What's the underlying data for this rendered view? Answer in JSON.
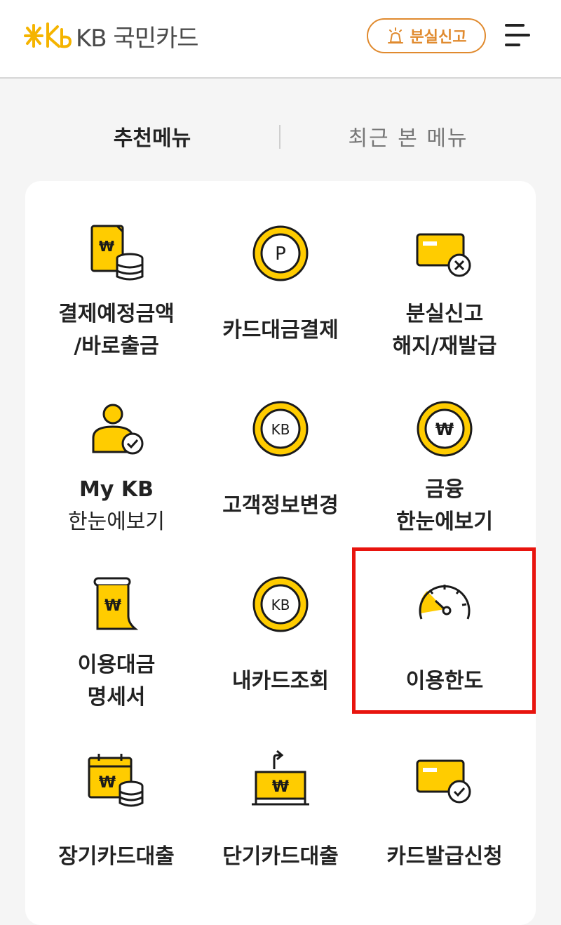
{
  "header": {
    "logo_text": "KB 국민카드",
    "lost_report_label": "분실신고"
  },
  "tabs": [
    {
      "label": "추천메뉴"
    },
    {
      "label": "최근 본 메뉴"
    }
  ],
  "menu": [
    {
      "icon": "bill-coins-icon",
      "lines": [
        "결제예정금액",
        "/바로출금"
      ]
    },
    {
      "icon": "point-coin-icon",
      "lines": [
        "카드대금결제"
      ]
    },
    {
      "icon": "card-cancel-icon",
      "lines": [
        "분실신고",
        "해지/재발급"
      ]
    },
    {
      "icon": "user-check-icon",
      "lines": [
        "My KB",
        "한눈에보기"
      ]
    },
    {
      "icon": "kb-coin-icon",
      "lines": [
        "고객정보변경"
      ]
    },
    {
      "icon": "won-coin-icon",
      "lines": [
        "금융",
        "한눈에보기"
      ]
    },
    {
      "icon": "statement-scroll-icon",
      "lines": [
        "이용대금",
        "명세서"
      ]
    },
    {
      "icon": "kb-coin-icon",
      "lines": [
        "내카드조회"
      ]
    },
    {
      "icon": "speedometer-icon",
      "lines": [
        "이용한도"
      ]
    },
    {
      "icon": "calendar-coins-icon",
      "lines": [
        "장기카드대출"
      ]
    },
    {
      "icon": "laptop-won-upload-icon",
      "lines": [
        "단기카드대출"
      ]
    },
    {
      "icon": "card-check-icon",
      "lines": [
        "카드발급신청"
      ]
    }
  ],
  "colors": {
    "accent": "#ffcc00",
    "lost_report": "#e08a2e",
    "highlight": "#e8140e"
  }
}
